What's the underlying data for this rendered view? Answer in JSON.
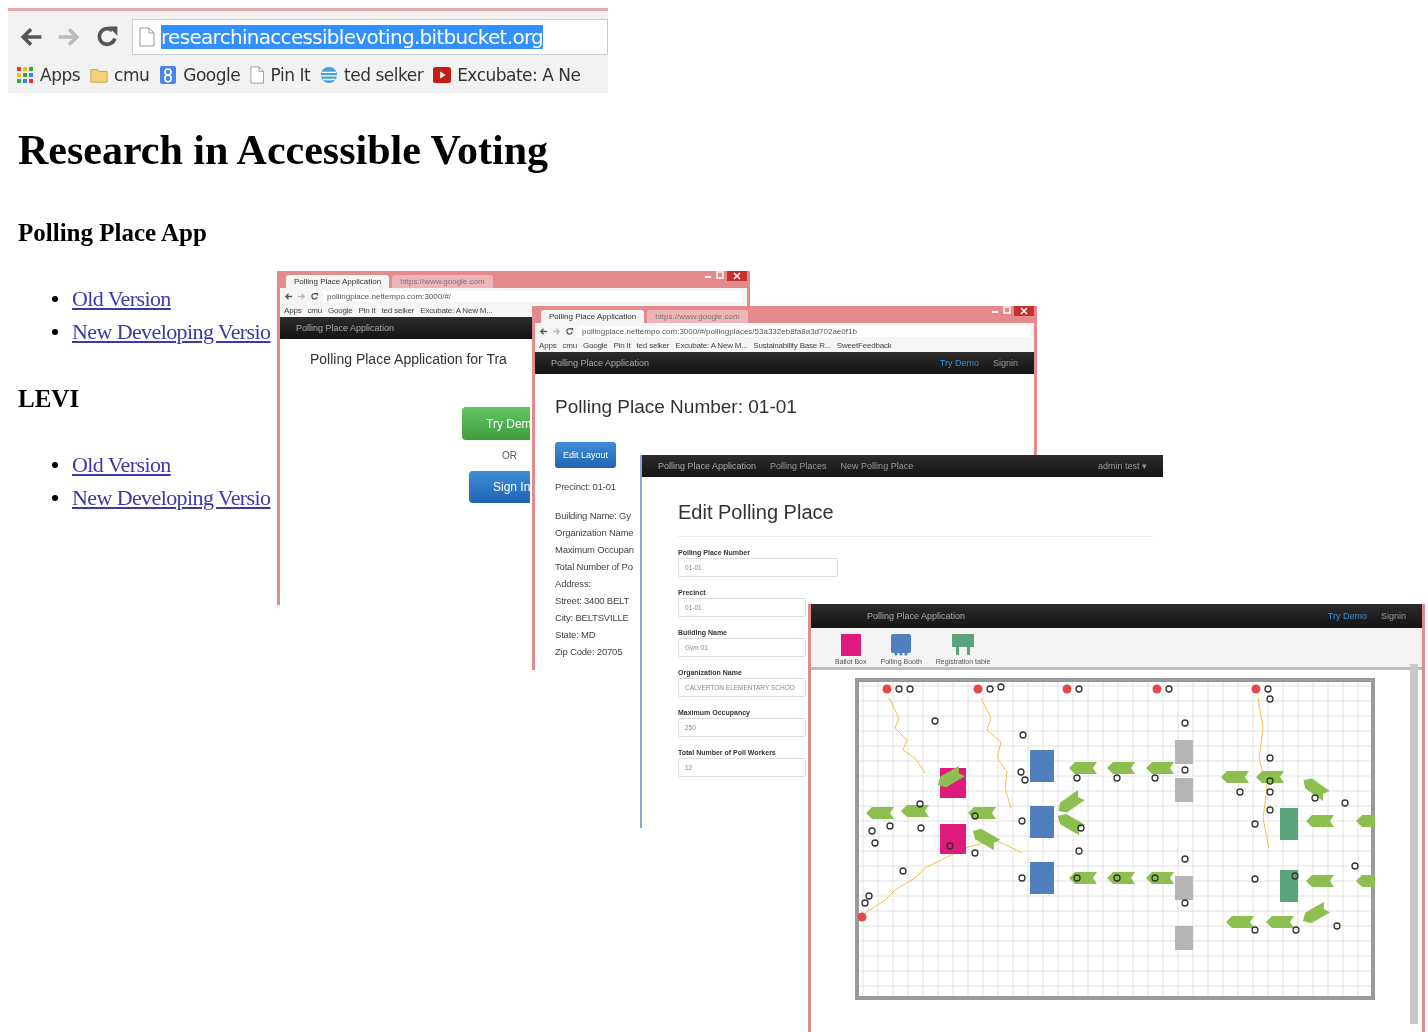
{
  "browser": {
    "url": "researchinaccessiblevoting.bitbucket.org",
    "bookmarks": [
      {
        "label": "Apps",
        "kind": "apps"
      },
      {
        "label": "cmu",
        "kind": "folder"
      },
      {
        "label": "Google",
        "kind": "google"
      },
      {
        "label": "Pin It",
        "kind": "page"
      },
      {
        "label": "ted selker",
        "kind": "globe"
      },
      {
        "label": "Excubate: A Ne",
        "kind": "video"
      }
    ]
  },
  "page": {
    "title": "Research in Accessible Voting",
    "sections": [
      {
        "heading": "Polling Place App",
        "links": [
          "Old Version",
          "New Developing Versio"
        ]
      },
      {
        "heading": "LEVI",
        "links": [
          "Old Version",
          "New Developing Versio"
        ]
      }
    ]
  },
  "landing_window": {
    "tabs": [
      {
        "label": "Polling Place Application",
        "selected": true
      },
      {
        "label": "https://www.google.com",
        "selected": false
      }
    ],
    "url": "pollingplace.nettempo.com:3000/#/",
    "bookmarks": [
      "Apps",
      "cmu",
      "Google",
      "Pin It",
      "ted selker",
      "Excubate: A New M..."
    ],
    "brand": "Polling Place Application",
    "heading": "Polling Place Application for Tra",
    "buttons": [
      {
        "label": "Try Dem",
        "kind": "success"
      },
      {
        "label": "Sign In",
        "kind": "primary"
      }
    ],
    "separator": "OR"
  },
  "details_window": {
    "tabs": [
      {
        "label": "Polling Place Application",
        "selected": true
      },
      {
        "label": "https://www.google.com",
        "selected": false
      }
    ],
    "url": "pollingplace.nettempo.com:3000/#/pollingplaces/53a332eb8fa8a3d702ae0f1b",
    "bookmarks": [
      "Apps",
      "cmu",
      "Google",
      "Pin It",
      "ted selker",
      "Excubate: A New M...",
      "Sustainability Base R...",
      "SweetFeedback"
    ],
    "brand": "Polling Place Application",
    "nav_links": [
      {
        "label": "Try Demo",
        "kind": "link"
      },
      {
        "label": "Signin",
        "kind": "plain"
      }
    ],
    "heading": "Polling Place Number: 01-01",
    "button": "Edit Layout",
    "details": [
      "Precinct: 01-01",
      "Building Name: Gy",
      "Organization Name",
      "Maximum Occupan",
      "Total Number of Po",
      "Address:",
      "Street: 3400 BELT",
      "City: BELTSVILLE",
      "State: MD",
      "Zip Code: 20705"
    ]
  },
  "edit_window": {
    "brand": "Polling Place Application",
    "nav_links": [
      "Polling Places",
      "New Polling Place"
    ],
    "user_menu": "admin test",
    "user_menu_caret": "▾",
    "heading": "Edit Polling Place",
    "fields": [
      {
        "label": "Polling Place Number",
        "value": "01-01"
      },
      {
        "label": "Precinct",
        "value": "01-01"
      },
      {
        "label": "Building Name",
        "value": "Gym 01"
      },
      {
        "label": "Organization Name",
        "value": "CALVERTON ELEMENTARY SCHOO"
      },
      {
        "label": "Maximum Occupancy",
        "value": "250"
      },
      {
        "label": "Total Number of Poll Workers",
        "value": "12"
      }
    ]
  },
  "layout_window": {
    "brand": "Polling Place Application",
    "nav_links": [
      {
        "label": "Try Demo",
        "kind": "link"
      },
      {
        "label": "Signin",
        "kind": "plain"
      }
    ],
    "palette": [
      {
        "label": "Ballot Box",
        "kind": "ballot_box"
      },
      {
        "label": "Polling Booth",
        "kind": "booth"
      },
      {
        "label": "Registration table",
        "kind": "table"
      }
    ]
  }
}
